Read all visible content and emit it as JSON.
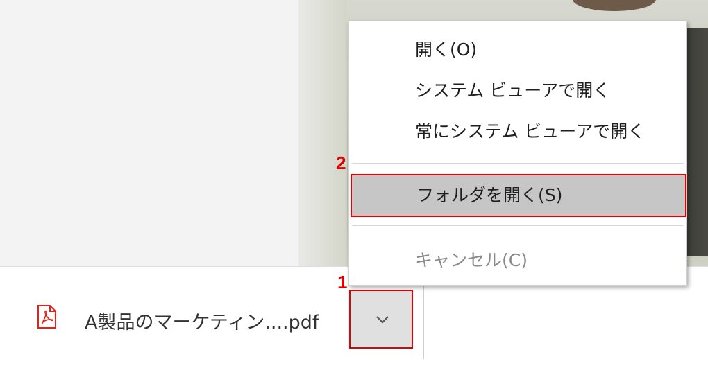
{
  "download": {
    "file_name": "A製品のマーケティン....pdf",
    "file_icon": "pdf-icon"
  },
  "context_menu": {
    "items": [
      {
        "label": "開く(O)",
        "enabled": true
      },
      {
        "label": "システム ビューアで開く",
        "enabled": true
      },
      {
        "label": "常にシステム ビューアで開く",
        "enabled": true
      },
      {
        "label": "フォルダを開く(S)",
        "enabled": true,
        "highlighted": true
      },
      {
        "label": "キャンセル(C)",
        "enabled": false
      }
    ]
  },
  "annotations": {
    "step1": "1",
    "step2": "2"
  },
  "colors": {
    "annotation_red": "#e60000",
    "pdf_red": "#e2231a",
    "highlight_gray": "#c6c6c6"
  }
}
